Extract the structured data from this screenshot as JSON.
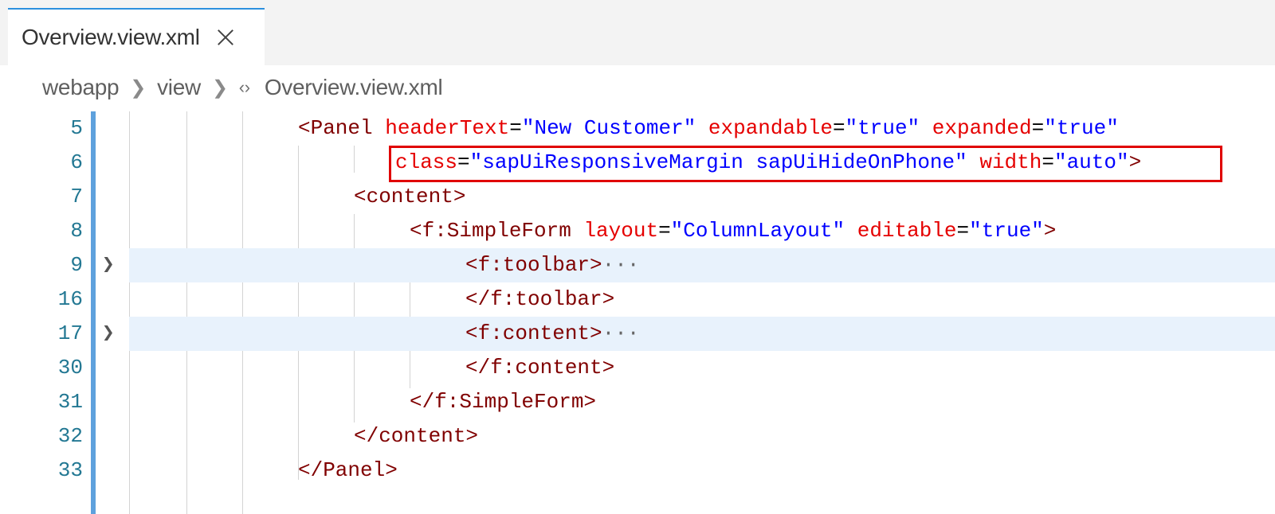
{
  "tab": {
    "label": "Overview.view.xml"
  },
  "breadcrumb": {
    "items": [
      "webapp",
      "view",
      "Overview.view.xml"
    ]
  },
  "lines": [
    {
      "n": "5",
      "tokens": {
        "a": "<Panel ",
        "b": "headerText",
        "c": "=",
        "d": "\"New Customer\"",
        "e": " expandable",
        "f": "=",
        "g": "\"true\"",
        "h": " expanded",
        "i": "=",
        "j": "\"true\""
      }
    },
    {
      "n": "6",
      "tokens": {
        "a": "class",
        "b": "=",
        "c": "\"sapUiResponsiveMargin sapUiHideOnPhone\"",
        "d": " width",
        "e": "=",
        "f": "\"auto\"",
        "g": ">"
      }
    },
    {
      "n": "7",
      "tokens": {
        "a": "<content>"
      }
    },
    {
      "n": "8",
      "tokens": {
        "a": "<f:SimpleForm ",
        "b": "layout",
        "c": "=",
        "d": "\"ColumnLayout\"",
        "e": " editable",
        "f": "=",
        "g": "\"true\"",
        "h": ">"
      }
    },
    {
      "n": "9",
      "tokens": {
        "a": "<f:toolbar>",
        "b": "···"
      }
    },
    {
      "n": "16",
      "tokens": {
        "a": "</f:toolbar>"
      }
    },
    {
      "n": "17",
      "tokens": {
        "a": "<f:content>",
        "b": "···"
      }
    },
    {
      "n": "30",
      "tokens": {
        "a": "</f:content>"
      }
    },
    {
      "n": "31",
      "tokens": {
        "a": "</f:SimpleForm>"
      }
    },
    {
      "n": "32",
      "tokens": {
        "a": "</content>"
      }
    },
    {
      "n": "33",
      "tokens": {
        "a": "</Panel>"
      }
    }
  ],
  "icons": {
    "close": "close-icon",
    "xml": "xml-file-icon",
    "fold": "chevron-right-icon"
  },
  "colors": {
    "tab_accent": "#2b8fde",
    "gutter_accent": "#5ea1dd",
    "highlight_box": "#e00000",
    "folded_line_bg": "#e8f2fc"
  }
}
